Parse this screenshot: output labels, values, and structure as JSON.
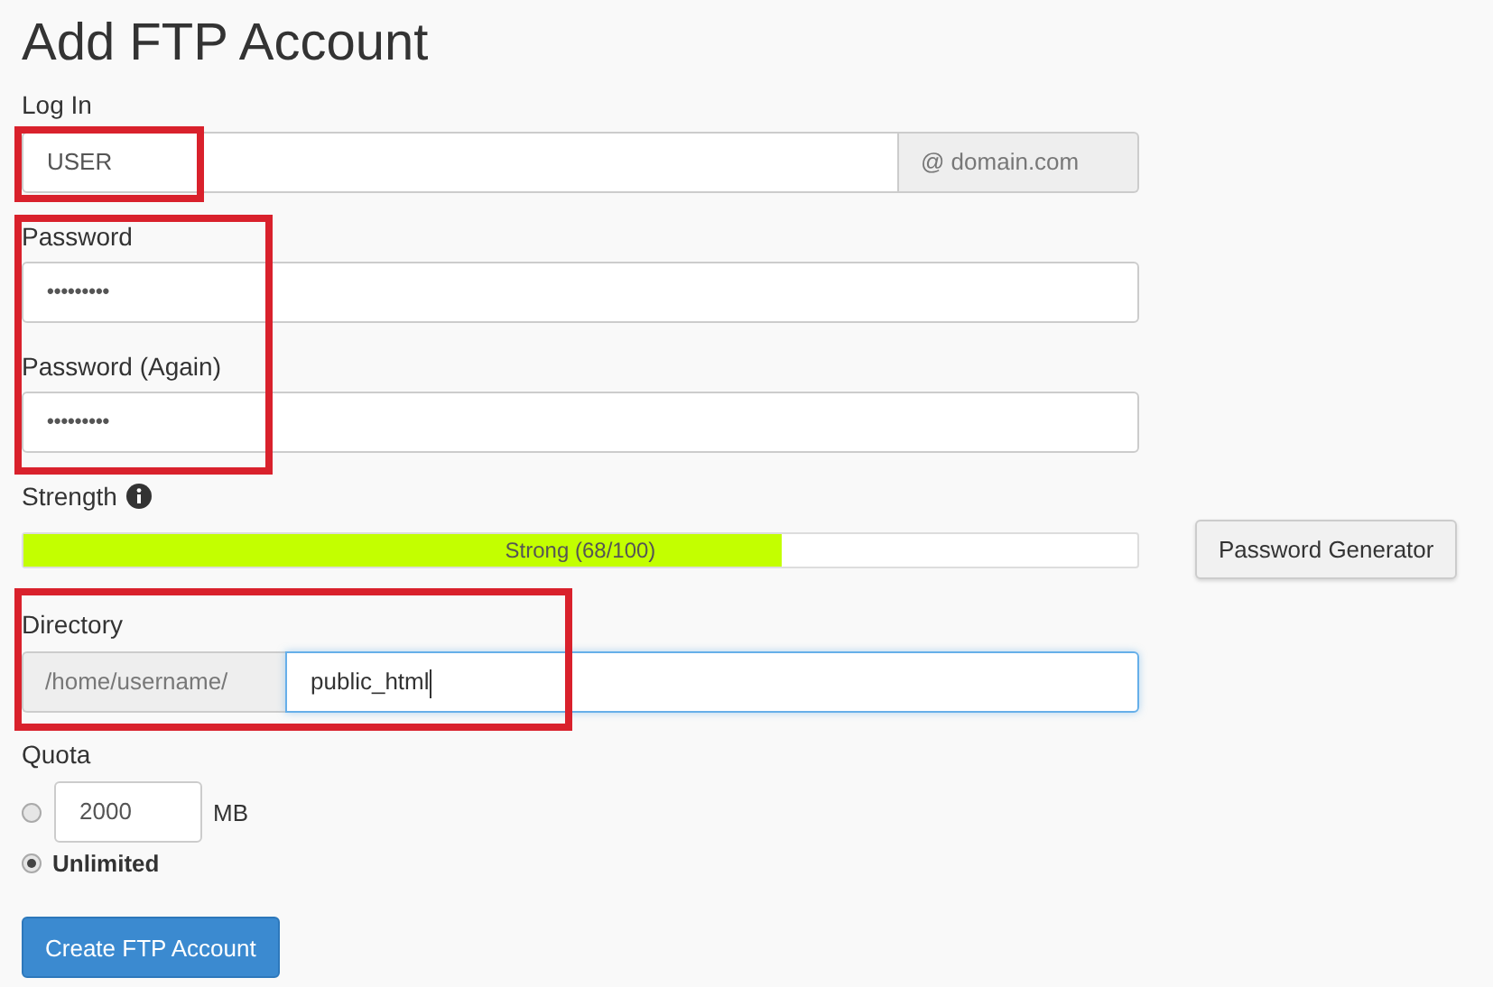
{
  "title": "Add FTP Account",
  "login": {
    "label": "Log In",
    "value": "USER",
    "domain": "@ domain.com"
  },
  "passwords": [
    {
      "label": "Password",
      "value": "•••••••••"
    },
    {
      "label": "Password (Again)",
      "value": "•••••••••"
    }
  ],
  "strength": {
    "label": "Strength",
    "level": 0.68,
    "text": "Strong (68/100)"
  },
  "generator_button": "Password Generator",
  "directory": {
    "label": "Directory",
    "prefix": "/home/username/",
    "value": "public_html"
  },
  "quota": {
    "label": "Quota",
    "options": [
      {
        "kind": "amount",
        "value": "2000",
        "unit": "MB",
        "selected": false
      },
      {
        "kind": "text",
        "text": "Unlimited",
        "selected": true
      }
    ]
  },
  "submit_button": "Create FTP Account"
}
